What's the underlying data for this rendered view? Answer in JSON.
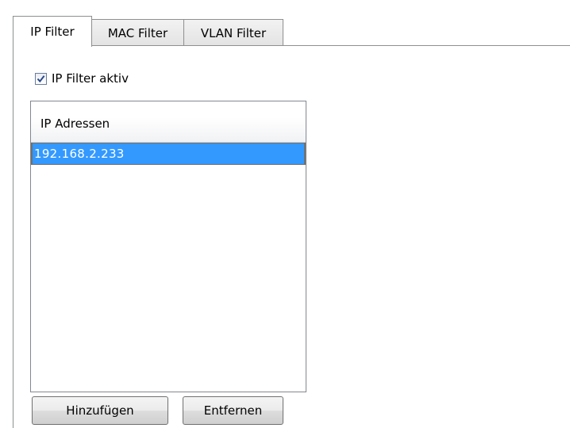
{
  "tabs": [
    {
      "label": "IP Filter",
      "active": true
    },
    {
      "label": "MAC Filter",
      "active": false
    },
    {
      "label": "VLAN Filter",
      "active": false
    }
  ],
  "filter": {
    "checkbox_label": "IP Filter aktiv",
    "checked": true
  },
  "list": {
    "header": "IP Adressen",
    "rows": [
      "192.168.2.233"
    ],
    "selected_color": "#3399ff"
  },
  "buttons": {
    "add_label": "Hinzufügen",
    "remove_label": "Entfernen"
  },
  "icons": {
    "checkbox": "checkmark-icon"
  }
}
